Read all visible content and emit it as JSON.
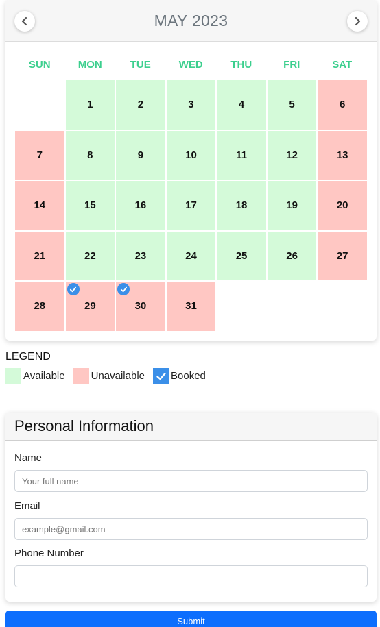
{
  "calendar": {
    "title": "MAY 2023",
    "weekdays": [
      "SUN",
      "MON",
      "TUE",
      "WED",
      "THU",
      "FRI",
      "SAT"
    ],
    "colors": {
      "available": "#d4fad9",
      "unavailable": "#ffc7c3",
      "booked": "#3b8fe8",
      "weekday": "#3ccf8e"
    },
    "days": [
      {
        "day": "",
        "status": "empty"
      },
      {
        "day": "1",
        "status": "available"
      },
      {
        "day": "2",
        "status": "available"
      },
      {
        "day": "3",
        "status": "available"
      },
      {
        "day": "4",
        "status": "available"
      },
      {
        "day": "5",
        "status": "available"
      },
      {
        "day": "6",
        "status": "unavailable"
      },
      {
        "day": "7",
        "status": "unavailable"
      },
      {
        "day": "8",
        "status": "available"
      },
      {
        "day": "9",
        "status": "available"
      },
      {
        "day": "10",
        "status": "available"
      },
      {
        "day": "11",
        "status": "available"
      },
      {
        "day": "12",
        "status": "available"
      },
      {
        "day": "13",
        "status": "unavailable"
      },
      {
        "day": "14",
        "status": "unavailable"
      },
      {
        "day": "15",
        "status": "available"
      },
      {
        "day": "16",
        "status": "available"
      },
      {
        "day": "17",
        "status": "available"
      },
      {
        "day": "18",
        "status": "available"
      },
      {
        "day": "19",
        "status": "available"
      },
      {
        "day": "20",
        "status": "unavailable"
      },
      {
        "day": "21",
        "status": "unavailable"
      },
      {
        "day": "22",
        "status": "available"
      },
      {
        "day": "23",
        "status": "available"
      },
      {
        "day": "24",
        "status": "available"
      },
      {
        "day": "25",
        "status": "available"
      },
      {
        "day": "26",
        "status": "available"
      },
      {
        "day": "27",
        "status": "unavailable"
      },
      {
        "day": "28",
        "status": "unavailable"
      },
      {
        "day": "29",
        "status": "unavailable",
        "booked": true
      },
      {
        "day": "30",
        "status": "unavailable",
        "booked": true
      },
      {
        "day": "31",
        "status": "unavailable"
      }
    ]
  },
  "legend": {
    "title": "LEGEND",
    "available": "Available",
    "unavailable": "Unavailable",
    "booked": "Booked"
  },
  "personal_info": {
    "title": "Personal Information",
    "name_label": "Name",
    "name_placeholder": "Your full name",
    "name_value": "",
    "email_label": "Email",
    "email_placeholder": "example@gmail.com",
    "email_value": "",
    "phone_label": "Phone Number",
    "phone_placeholder": "",
    "phone_value": ""
  },
  "submit_label": "Submit"
}
